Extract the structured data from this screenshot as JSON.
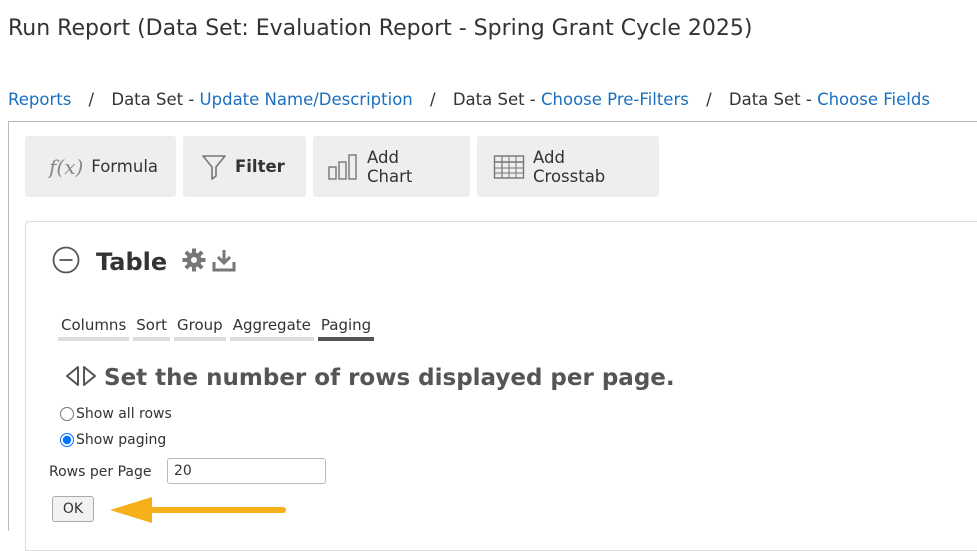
{
  "page": {
    "title": "Run Report (Data Set: Evaluation Report - Spring Grant Cycle 2025)"
  },
  "breadcrumb": {
    "items": [
      {
        "prefix": "",
        "link": "Reports"
      },
      {
        "prefix": "Data Set - ",
        "link": "Update Name/Description"
      },
      {
        "prefix": "Data Set - ",
        "link": "Choose Pre-Filters"
      },
      {
        "prefix": "Data Set - ",
        "link": "Choose Fields"
      }
    ],
    "separator": "/"
  },
  "toolbar": {
    "formula_icon": "f(x)",
    "formula_label": "Formula",
    "filter_label": "Filter",
    "chart_label": "Add Chart",
    "crosstab_label": "Add Crosstab"
  },
  "table_panel": {
    "title": "Table",
    "tabs": [
      "Columns",
      "Sort",
      "Group",
      "Aggregate",
      "Paging"
    ],
    "active_tab": "Paging",
    "section_title": "Set the number of rows displayed per page.",
    "radio_show_all": "Show all rows",
    "radio_show_paging": "Show paging",
    "selected_option": "Show paging",
    "rows_per_page_label": "Rows per Page",
    "rows_per_page_value": "20",
    "ok_label": "OK"
  },
  "colors": {
    "link": "#1a6fbf",
    "arrow": "#f5b01a",
    "button_bg": "#eeeeee"
  }
}
